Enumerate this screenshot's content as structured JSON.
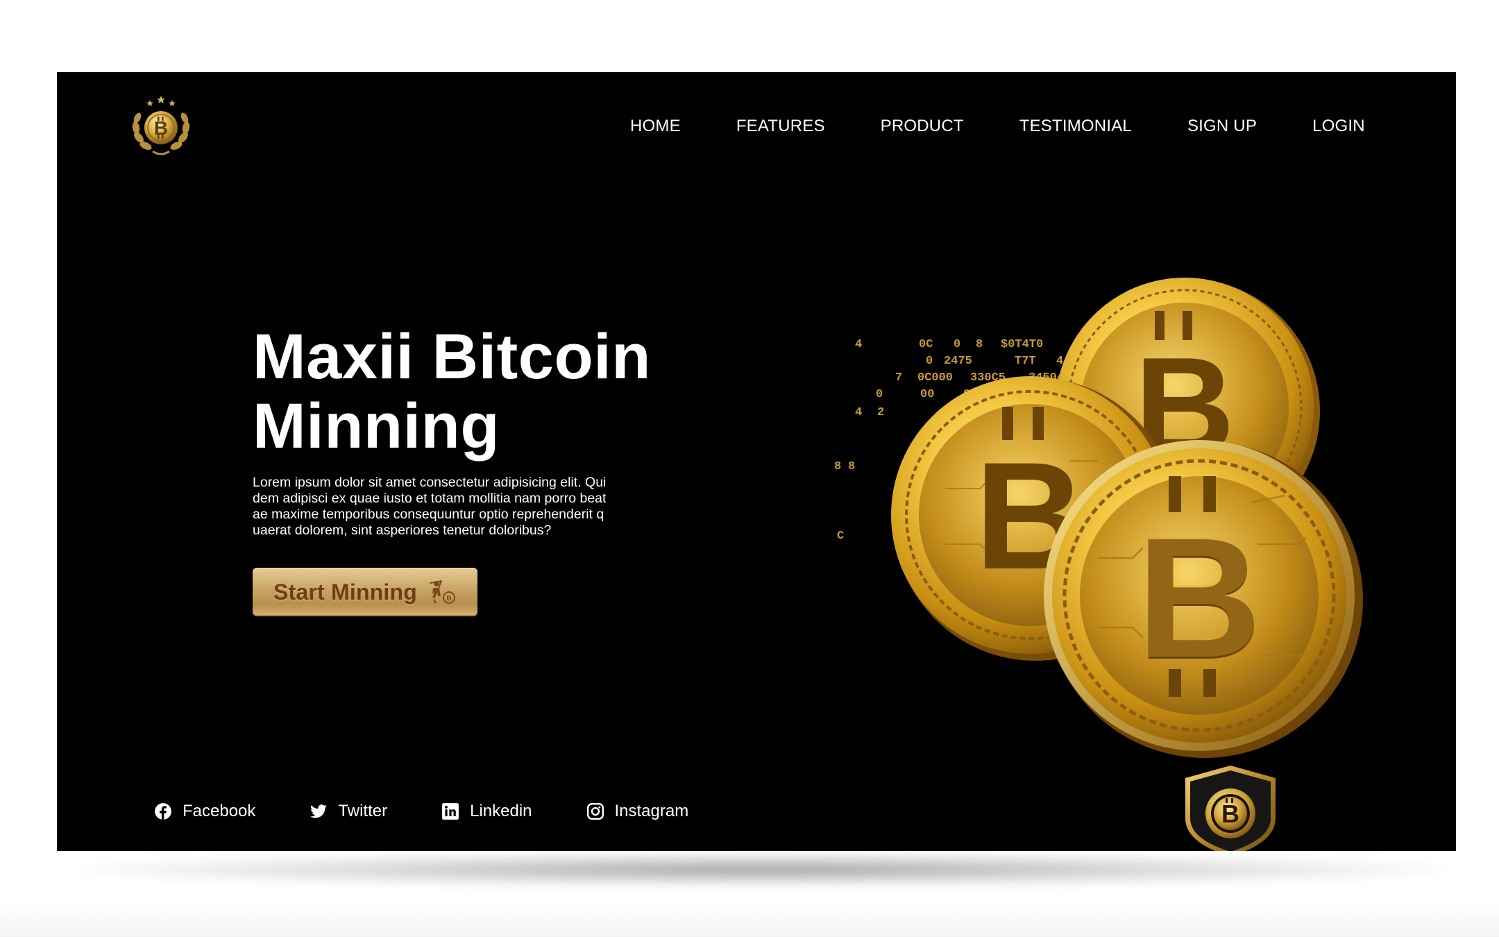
{
  "header": {
    "logo_icon": "bitcoin-laurel-logo",
    "nav": [
      {
        "label": "HOME"
      },
      {
        "label": "FEATURES"
      },
      {
        "label": "PRODUCT"
      },
      {
        "label": "TESTIMONIAL"
      },
      {
        "label": "SIGN UP"
      },
      {
        "label": "LOGIN"
      }
    ]
  },
  "hero": {
    "title_line1": "Maxii Bitcoin",
    "title_line2": "Minning",
    "description": "Lorem ipsum dolor sit amet consectetur adipisicing elit. Quidem adipisci ex quae iusto et totam mollitia nam porro beatae maxime temporibus consequuntur optio reprehenderit quaerat dolorem, sint asperiores tenetur doloribus?",
    "cta_label": "Start Minning",
    "cta_icon": "miner-icon",
    "image": "golden-bitcoin-coins"
  },
  "socials": [
    {
      "label": "Facebook",
      "icon": "facebook-icon"
    },
    {
      "label": "Twitter",
      "icon": "twitter-icon"
    },
    {
      "label": "Linkedin",
      "icon": "linkedin-icon"
    },
    {
      "label": "Instagram",
      "icon": "instagram-icon"
    }
  ],
  "badge_icon": "bitcoin-shield-icon",
  "colors": {
    "background": "#000000",
    "text": "#ffffff",
    "gold": "#d4a52a",
    "button_gold": "#c9a464",
    "button_text": "#6b3f14"
  }
}
